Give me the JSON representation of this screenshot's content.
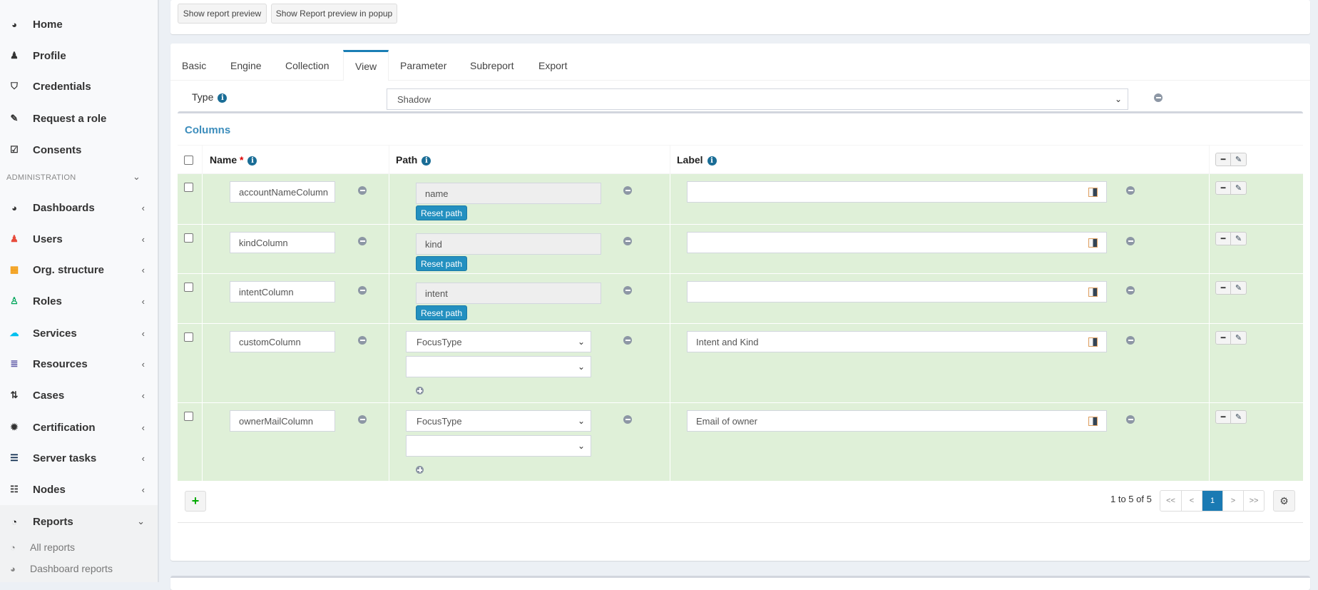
{
  "sidebar": {
    "items": [
      {
        "label": "Home",
        "icon": "dashboard-icon"
      },
      {
        "label": "Profile",
        "icon": "user-icon"
      },
      {
        "label": "Credentials",
        "icon": "shield-icon"
      },
      {
        "label": "Request a role",
        "icon": "edit-icon"
      },
      {
        "label": "Consents",
        "icon": "check-square-icon"
      }
    ],
    "section_header": "ADMINISTRATION",
    "admin_items": [
      {
        "label": "Dashboards",
        "icon": "dashboard-icon",
        "color": "#333333"
      },
      {
        "label": "Users",
        "icon": "user-icon",
        "color": "#e74c3c"
      },
      {
        "label": "Org. structure",
        "icon": "building-icon",
        "color": "#f39c12"
      },
      {
        "label": "Roles",
        "icon": "role-icon",
        "color": "#00a65a"
      },
      {
        "label": "Services",
        "icon": "cloud-icon",
        "color": "#00c0ef"
      },
      {
        "label": "Resources",
        "icon": "database-icon",
        "color": "#605ca8"
      },
      {
        "label": "Cases",
        "icon": "cases-icon",
        "color": "#333333"
      },
      {
        "label": "Certification",
        "icon": "certificate-icon",
        "color": "#333333"
      },
      {
        "label": "Server tasks",
        "icon": "tasks-icon",
        "color": "#0f2d4f"
      },
      {
        "label": "Nodes",
        "icon": "server-icon",
        "color": "#333333"
      },
      {
        "label": "Reports",
        "icon": "pie-chart-icon",
        "color": "#111111"
      }
    ],
    "sub_items": [
      {
        "label": "All reports",
        "icon": "pie-chart-icon"
      },
      {
        "label": "Dashboard reports",
        "icon": "dashboard-icon"
      }
    ]
  },
  "toolbar": {
    "show_preview": "Show report preview",
    "show_preview_popup": "Show Report preview in popup"
  },
  "tabs": [
    "Basic",
    "Engine",
    "Collection",
    "View",
    "Parameter",
    "Subreport",
    "Export"
  ],
  "active_tab": "View",
  "type_field": {
    "label": "Type",
    "value": "Shadow"
  },
  "columns": {
    "title": "Columns",
    "headers": {
      "name": "Name",
      "required": "*",
      "path": "Path",
      "label": "Label"
    },
    "reset_label": "Reset path",
    "rows": [
      {
        "name": "accountNameColumn",
        "path": "name",
        "label": ""
      },
      {
        "name": "kindColumn",
        "path": "kind",
        "label": ""
      },
      {
        "name": "intentColumn",
        "path": "intent",
        "label": ""
      },
      {
        "name": "customColumn",
        "path_type": "FocusType",
        "path_sub": "",
        "label": "Intent and Kind"
      },
      {
        "name": "ownerMailColumn",
        "path_type": "FocusType",
        "path_sub": "",
        "label": "Email of owner"
      }
    ]
  },
  "pagination": {
    "summary": "1 to 5 of 5",
    "first": "<<",
    "prev": "<",
    "current": "1",
    "next": ">",
    "last": ">>"
  },
  "colors": {
    "accent": "#1a7ab3",
    "row_bg": "#dff0d8",
    "link": "#3c8dbc"
  }
}
